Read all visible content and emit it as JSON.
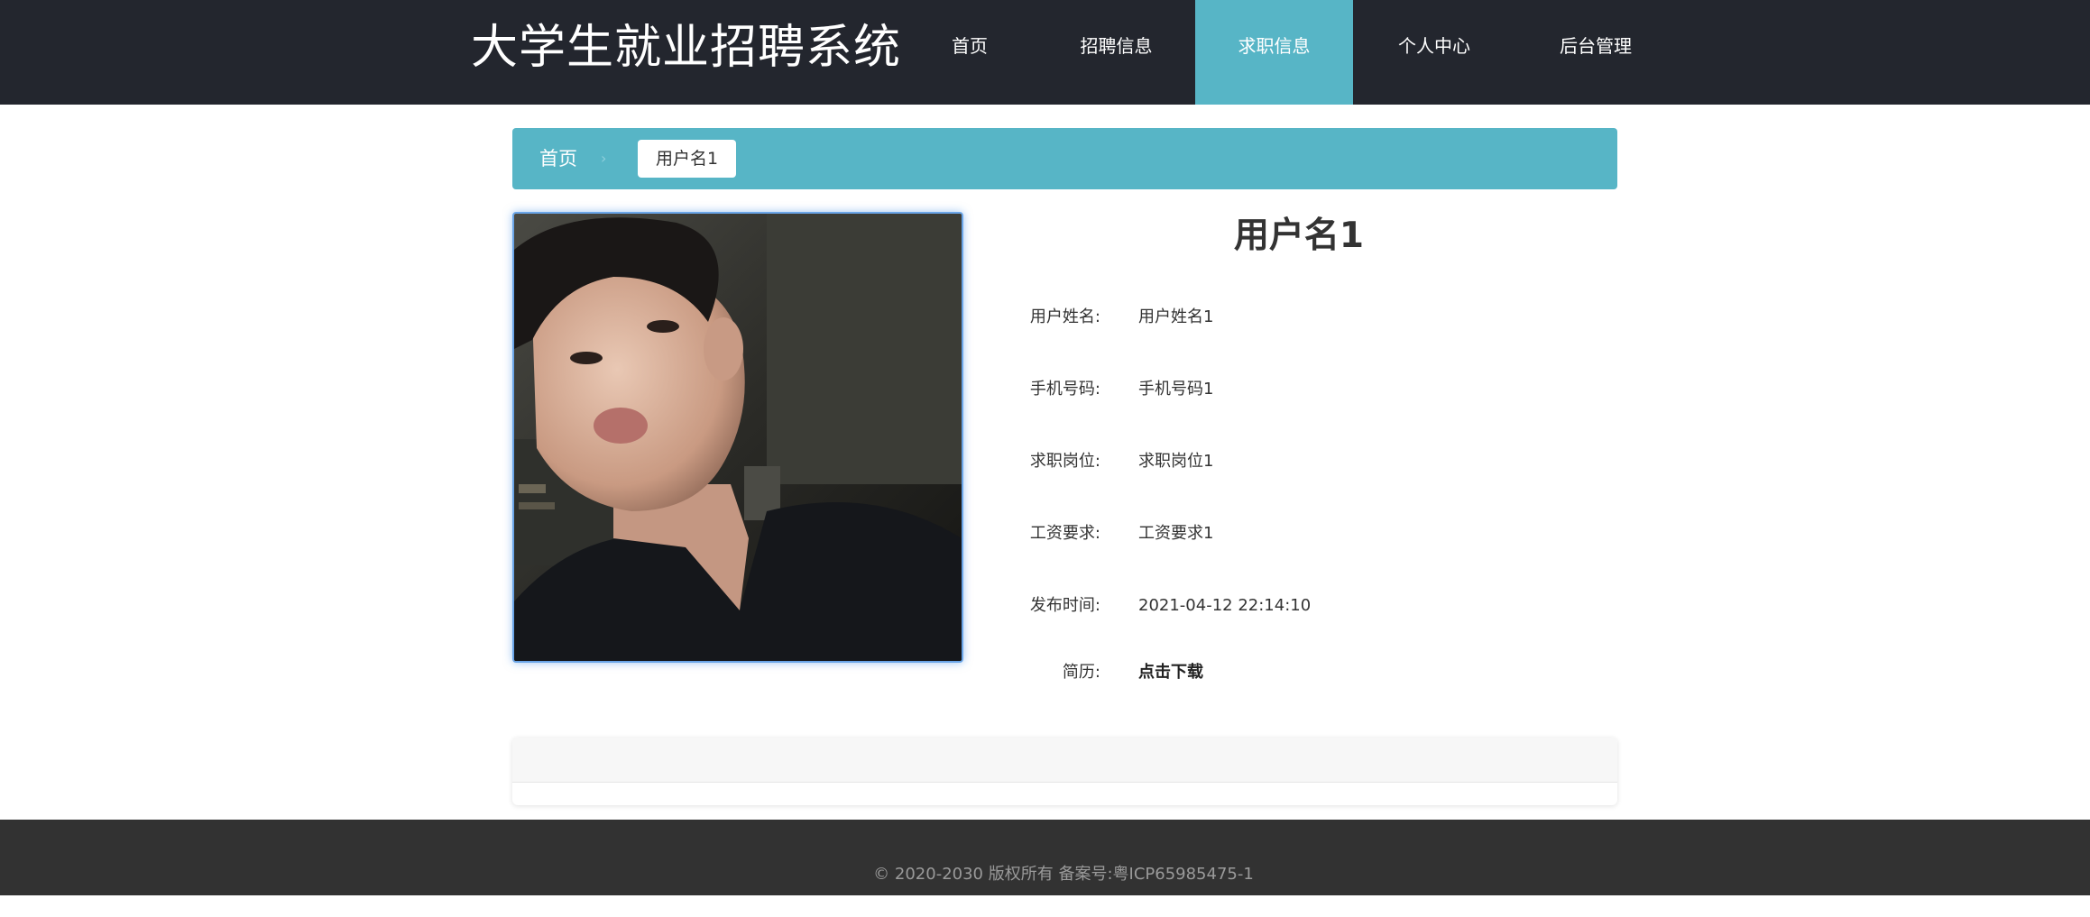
{
  "header": {
    "site_title": "大学生就业招聘系统",
    "nav": [
      {
        "label": "首页",
        "active": false
      },
      {
        "label": "招聘信息",
        "active": false
      },
      {
        "label": "求职信息",
        "active": true
      },
      {
        "label": "个人中心",
        "active": false
      },
      {
        "label": "后台管理",
        "active": false
      }
    ],
    "active_color": "#57b5c6",
    "background_color": "#23262e"
  },
  "breadcrumb": {
    "home": "首页",
    "separator": "›",
    "current": "用户名1"
  },
  "profile": {
    "title": "用户名1",
    "fields": [
      {
        "label": "用户姓名:",
        "value": "用户姓名1"
      },
      {
        "label": "手机号码:",
        "value": "手机号码1"
      },
      {
        "label": "求职岗位:",
        "value": "求职岗位1"
      },
      {
        "label": "工资要求:",
        "value": "工资要求1"
      },
      {
        "label": "发布时间:",
        "value": "2021-04-12 22:14:10"
      }
    ],
    "resume": {
      "label": "简历:",
      "link_text": "点击下载"
    }
  },
  "footer": {
    "text": "© 2020-2030 版权所有 备案号:粤ICP65985475-1"
  }
}
